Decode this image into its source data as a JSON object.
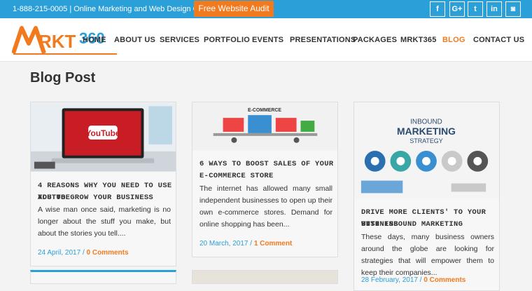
{
  "topbar": {
    "phone": "1-888-215-0005 | Online Marketing and Web Design Company",
    "audit_label": "Free Website Audit",
    "social": [
      {
        "icon": "facebook-icon",
        "glyph": "f"
      },
      {
        "icon": "google-plus-icon",
        "glyph": "G+"
      },
      {
        "icon": "twitter-icon",
        "glyph": "t"
      },
      {
        "icon": "linkedin-icon",
        "glyph": "in"
      },
      {
        "icon": "instagram-icon",
        "glyph": "◙"
      }
    ]
  },
  "logo": {
    "text": "MRKT360"
  },
  "nav": [
    "HOME",
    "ABOUT US",
    "SERVICES",
    "PORTFOLIO",
    "EVENTS",
    "PRESENTATIONS",
    "PACKAGES",
    "MRKT365",
    "BLOG",
    "CONTACT US"
  ],
  "nav_active": "BLOG",
  "page_title": "Blog Post",
  "posts": [
    {
      "title_line1": "4 REASONS WHY YOU NEED TO USE YOUTUBE",
      "title_line2": "ADS TO GROW YOUR BUSINESS",
      "body": "A wise man once said, marketing is no longer about the stuff you make, but about the stories you tell....",
      "date": "24 April, 2017",
      "separator": "/",
      "comments": "0 Comments",
      "thumb_label": "YouTube"
    },
    {
      "title_line1": "6 WAYS TO BOOST SALES OF YOUR",
      "title_line2": "E-COMMERCE STORE",
      "body": "The internet has allowed many small independent businesses to open up their own e-commerce stores. Demand for online shopping has been...",
      "date": "20 March, 2017",
      "separator": "/",
      "comments": "1 Comment",
      "thumb_label": "E-COMMERCE"
    },
    {
      "title_line1": "DRIVE MORE CLIENTS' TO YOUR BUSINESS",
      "title_line2": "WITH INBOUND MARKETING",
      "body": "These days, many business owners around the globe are looking for strategies that will empower them to keep their companies...",
      "date": "28 February, 2017",
      "separator": "/",
      "comments": "0 Comments",
      "thumb_label_1": "INBOUND",
      "thumb_label_2": "MARKETING",
      "thumb_label_3": "STRATEGY"
    }
  ],
  "colors": {
    "accent_blue": "#2a9fd8",
    "accent_orange": "#f27a1e"
  }
}
